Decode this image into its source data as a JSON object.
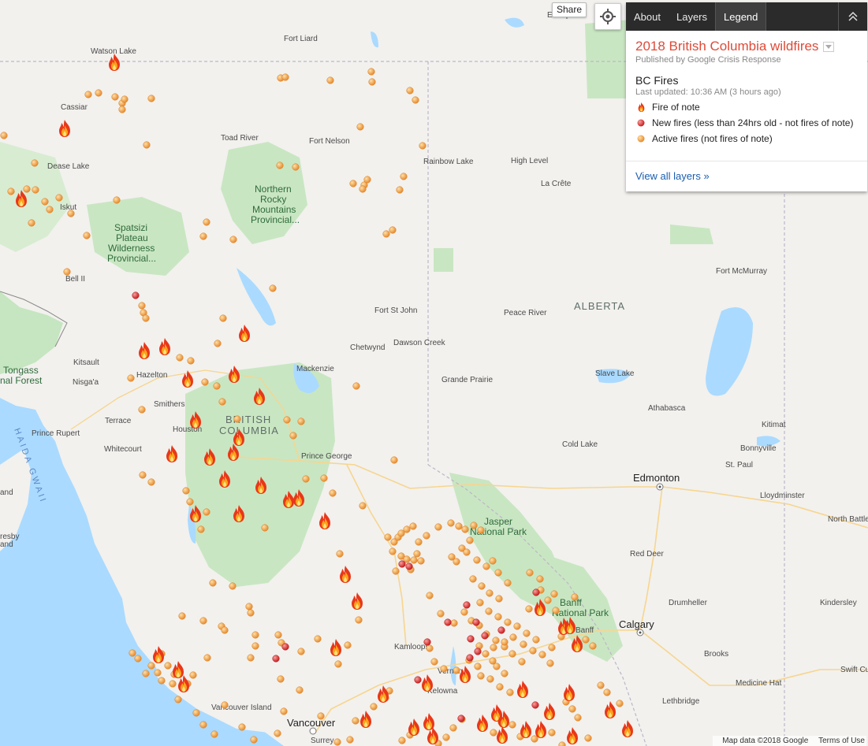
{
  "controls": {
    "share_label": "Share",
    "locate_icon": "crosshair-icon"
  },
  "panel": {
    "tabs": [
      {
        "label": "About"
      },
      {
        "label": "Layers"
      },
      {
        "label": "Legend",
        "active": true
      }
    ],
    "collapse_icon": "chevron-up-icon",
    "title": "2018 British Columbia wildfires",
    "publisher": "Published by Google Crisis Response",
    "layer_name": "BC Fires",
    "last_updated": "Last updated: 10:36 AM (3 hours ago)",
    "legend": [
      {
        "label": "Fire of note",
        "icon": "flame-icon"
      },
      {
        "label": "New fires (less than 24hrs old - not fires of note)",
        "icon": "red-dot-icon"
      },
      {
        "label": "Active fires (not fires of note)",
        "icon": "orange-dot-icon"
      }
    ],
    "view_all": "View all layers »"
  },
  "map_labels": {
    "provinces": [
      "BRITISH",
      "COLUMBIA",
      "ALBERTA"
    ],
    "cities_major": [
      "Edmonton",
      "Calgary",
      "Vancouver"
    ],
    "towns": [
      "Enterprise",
      "Fort Liard",
      "Watson Lake",
      "Cassiar",
      "Toad River",
      "Fort Nelson",
      "Rainbow Lake",
      "High Level",
      "La Crête",
      "Dease Lake",
      "Iskut",
      "Bell II",
      "Fort McMurray",
      "Fort St John",
      "Peace River",
      "Chetwynd",
      "Dawson Creek",
      "Kitsault",
      "Hazelton",
      "Nisga'a",
      "Mackenzie",
      "Grande Prairie",
      "Slave Lake",
      "Smithers",
      "Houston",
      "Terrace",
      "Prince Rupert",
      "Athabasca",
      "Kitimat",
      "Whitecourt",
      "Cold Lake",
      "Bonnyville",
      "St. Paul",
      "Prince George",
      "Lloydminster",
      "North Battleford",
      "Red Deer",
      "Drumheller",
      "Kindersley",
      "Banff",
      "Kamloops",
      "Vernon",
      "Kelowna",
      "Brooks",
      "Swift Cu",
      "Medicine Hat",
      "Lethbridge",
      "Vancouver Island",
      "Surrey",
      "Tongass",
      "nal Forest",
      "and",
      "resby",
      "and"
    ],
    "parks": [
      "Northern Rocky Mountains Provincial...",
      "Spatsizi Plateau Wilderness Provincial...",
      "Jasper National Park",
      "Banff National Park"
    ],
    "water": "HAIDA GWAII"
  },
  "colors": {
    "title_red": "#dd4b39",
    "fire_orange": "#f39a3c",
    "new_fire_red": "#d83131",
    "park_green": "#c9e6c2",
    "water_blue": "#aadaff"
  },
  "footer": {
    "map_data": "Map data ©2018 Google",
    "terms": "Terms of Use"
  }
}
